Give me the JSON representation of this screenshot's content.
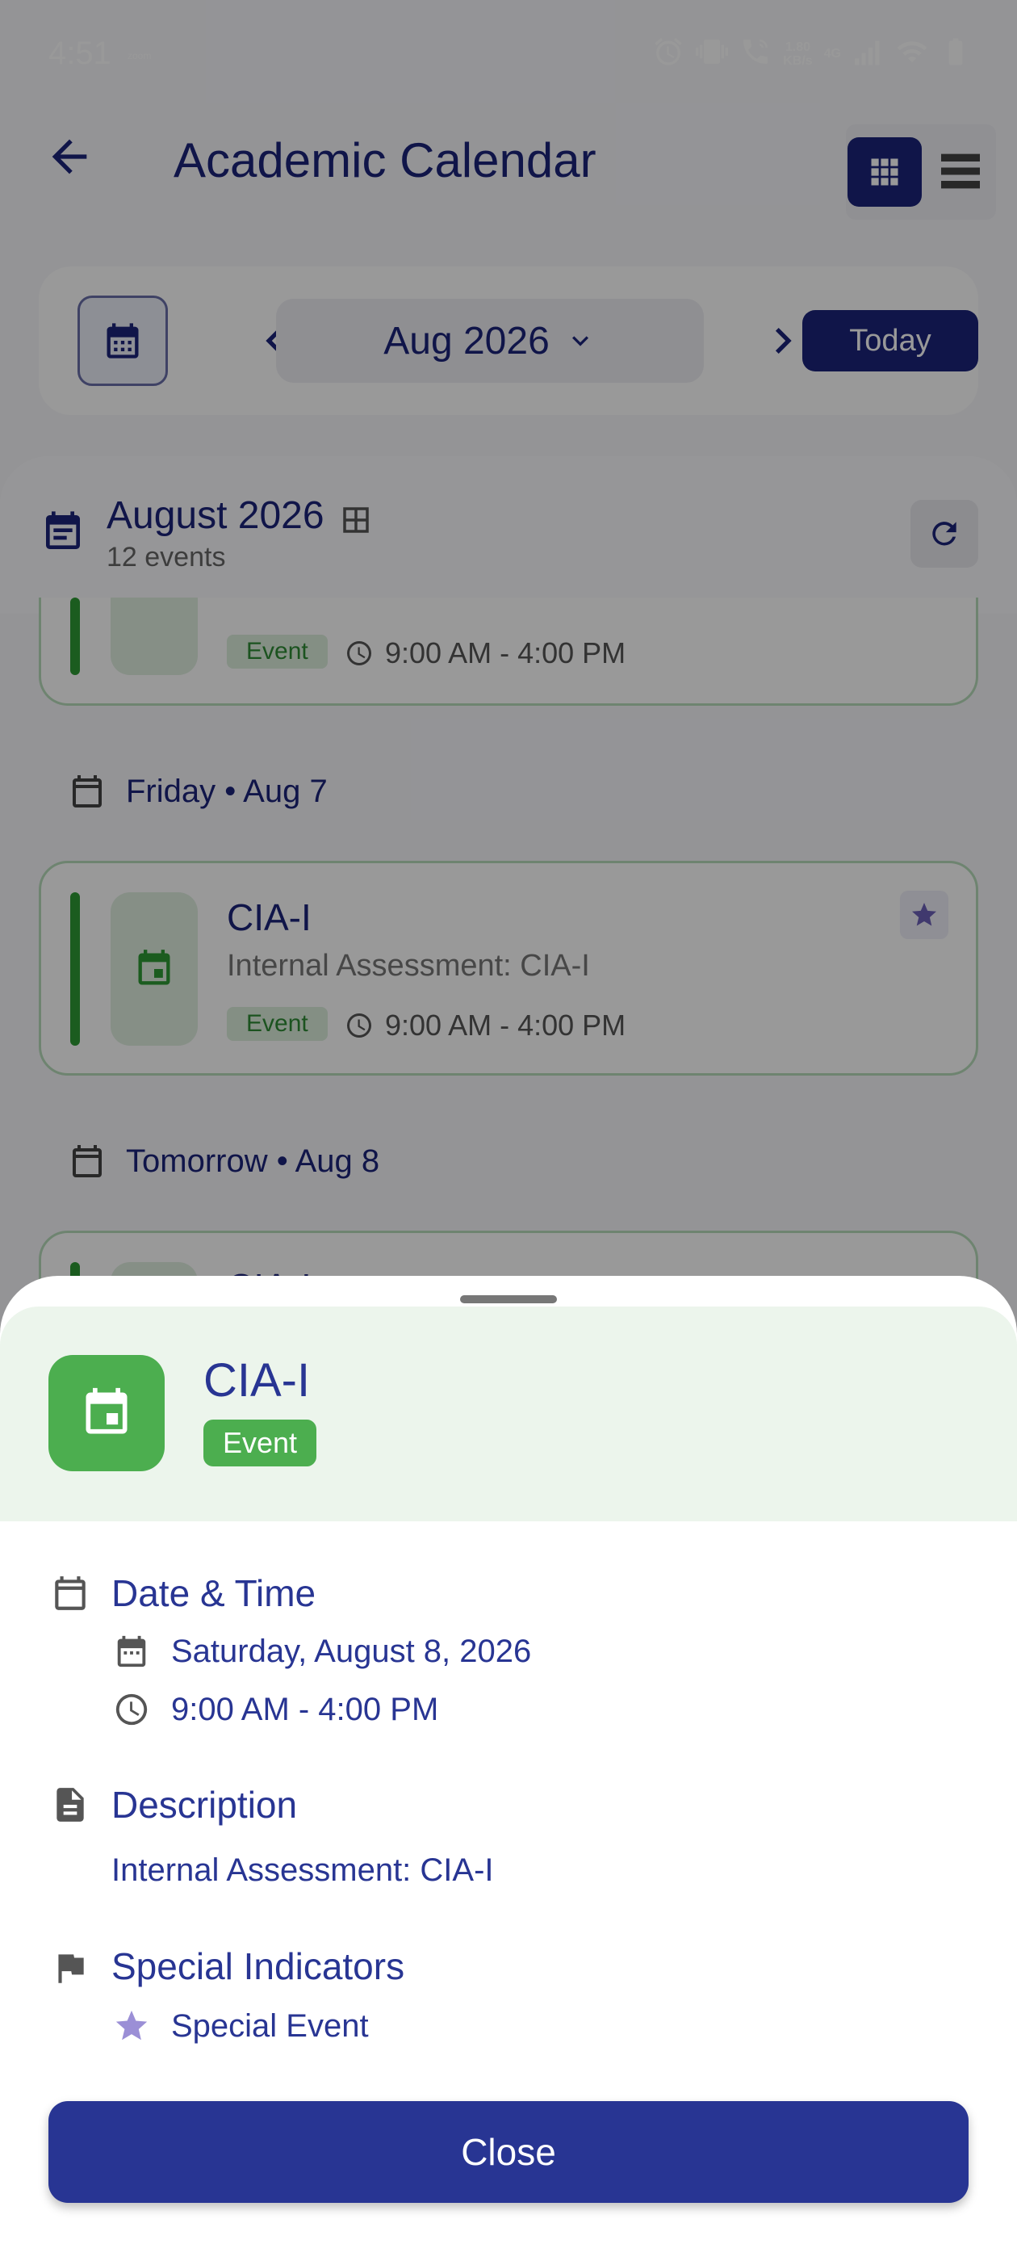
{
  "status_bar": {
    "time": "4:51",
    "mini_label": "zoom",
    "net_speed_value": "1.80",
    "net_speed_unit": "KB/s",
    "network": "4G"
  },
  "app_bar": {
    "title": "Academic Calendar"
  },
  "navigator": {
    "month": "Aug 2026",
    "today_label": "Today"
  },
  "list_header": {
    "title": "August 2026",
    "count": "12 events"
  },
  "events": [
    {
      "title": "",
      "description": "",
      "tag": "Event",
      "time": "9:00 AM - 4:00 PM"
    },
    {
      "title": "CIA-I",
      "description": "Internal Assessment: CIA-I",
      "tag": "Event",
      "time": "9:00 AM - 4:00 PM"
    },
    {
      "title": "CIA-I"
    }
  ],
  "day_headers": [
    "Friday • Aug 7",
    "Tomorrow • Aug 8"
  ],
  "sheet": {
    "title": "CIA-I",
    "type": "Event",
    "date_time_label": "Date & Time",
    "date": "Saturday, August 8, 2026",
    "time": "9:00 AM - 4:00 PM",
    "description_label": "Description",
    "description": "Internal Assessment: CIA-I",
    "special_label": "Special Indicators",
    "special_item": "Special Event",
    "close_label": "Close"
  },
  "colors": {
    "primary": "#1b237a",
    "sheet_primary": "#283593",
    "event_green": "#4cae4f",
    "star_purple": "#9b8fd6"
  }
}
